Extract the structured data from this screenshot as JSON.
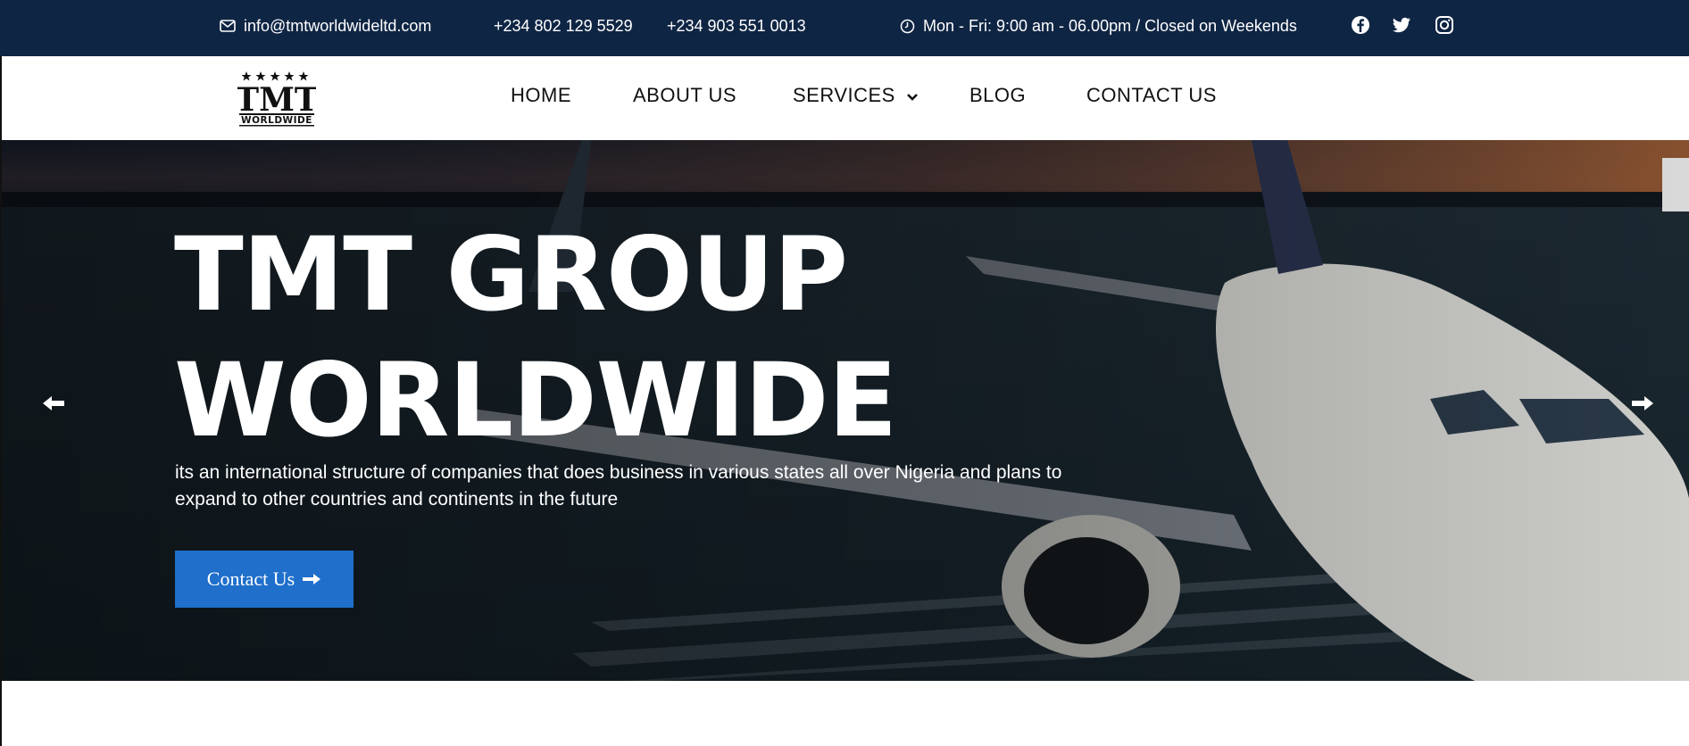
{
  "topbar": {
    "email": "info@tmtworldwideltd.com",
    "phone1": "+234 802 129 5529",
    "phone2": "+234 903 551 0013",
    "hours": "Mon - Fri: 9:00 am - 06.00pm / Closed on Weekends",
    "social": [
      "facebook-icon",
      "twitter-icon",
      "instagram-icon"
    ]
  },
  "logo": {
    "letters": "TMT",
    "wordmark": "WORLDWIDE",
    "stars": "★★★★★"
  },
  "nav": {
    "home": "HOME",
    "about": "ABOUT US",
    "services": "SERVICES",
    "blog": "BLOG",
    "contact": "CONTACT US"
  },
  "hero": {
    "title_line1": "TMT GROUP",
    "title_line2": "WORLDWIDE",
    "subtitle": "its an international structure of companies that does business in various states all over Nigeria and plans to expand to other countries and continents in the future",
    "button_label": "Contact Us",
    "button_icon": "arrow-right-icon"
  },
  "colors": {
    "topbar_bg": "#0f2544",
    "accent": "#1f6fcb",
    "text_dark": "#111111"
  }
}
